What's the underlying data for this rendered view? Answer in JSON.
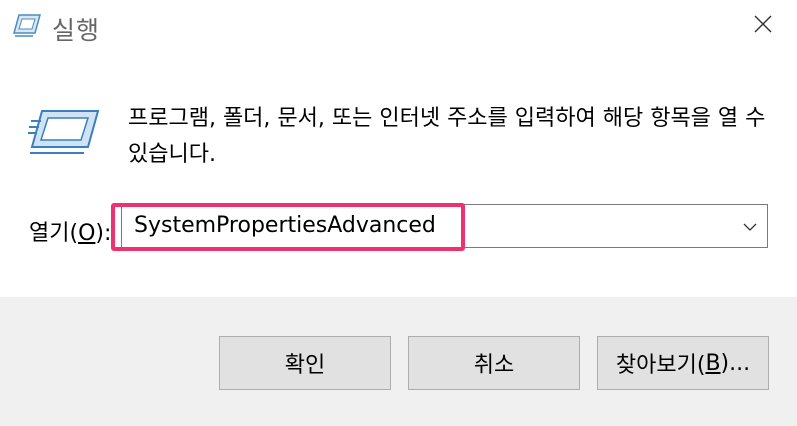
{
  "window": {
    "title": "실행",
    "close_icon": "close-icon"
  },
  "content": {
    "message": "프로그램, 폴더, 문서, 또는 인터넷 주소를 입력하여 해당 항목을 열 수 있습니다.",
    "open_label_prefix": "열기(",
    "open_label_key": "O",
    "open_label_suffix": "):",
    "input_value": "SystemPropertiesAdvanced",
    "dropdown_icon": "chevron-down-icon"
  },
  "buttons": {
    "ok": "확인",
    "cancel": "취소",
    "browse_prefix": "찾아보기(",
    "browse_key": "B",
    "browse_suffix": ")..."
  },
  "colors": {
    "highlight": "#f0316f",
    "footer_bg": "#f0f0f0",
    "button_bg": "#e1e1e1"
  }
}
